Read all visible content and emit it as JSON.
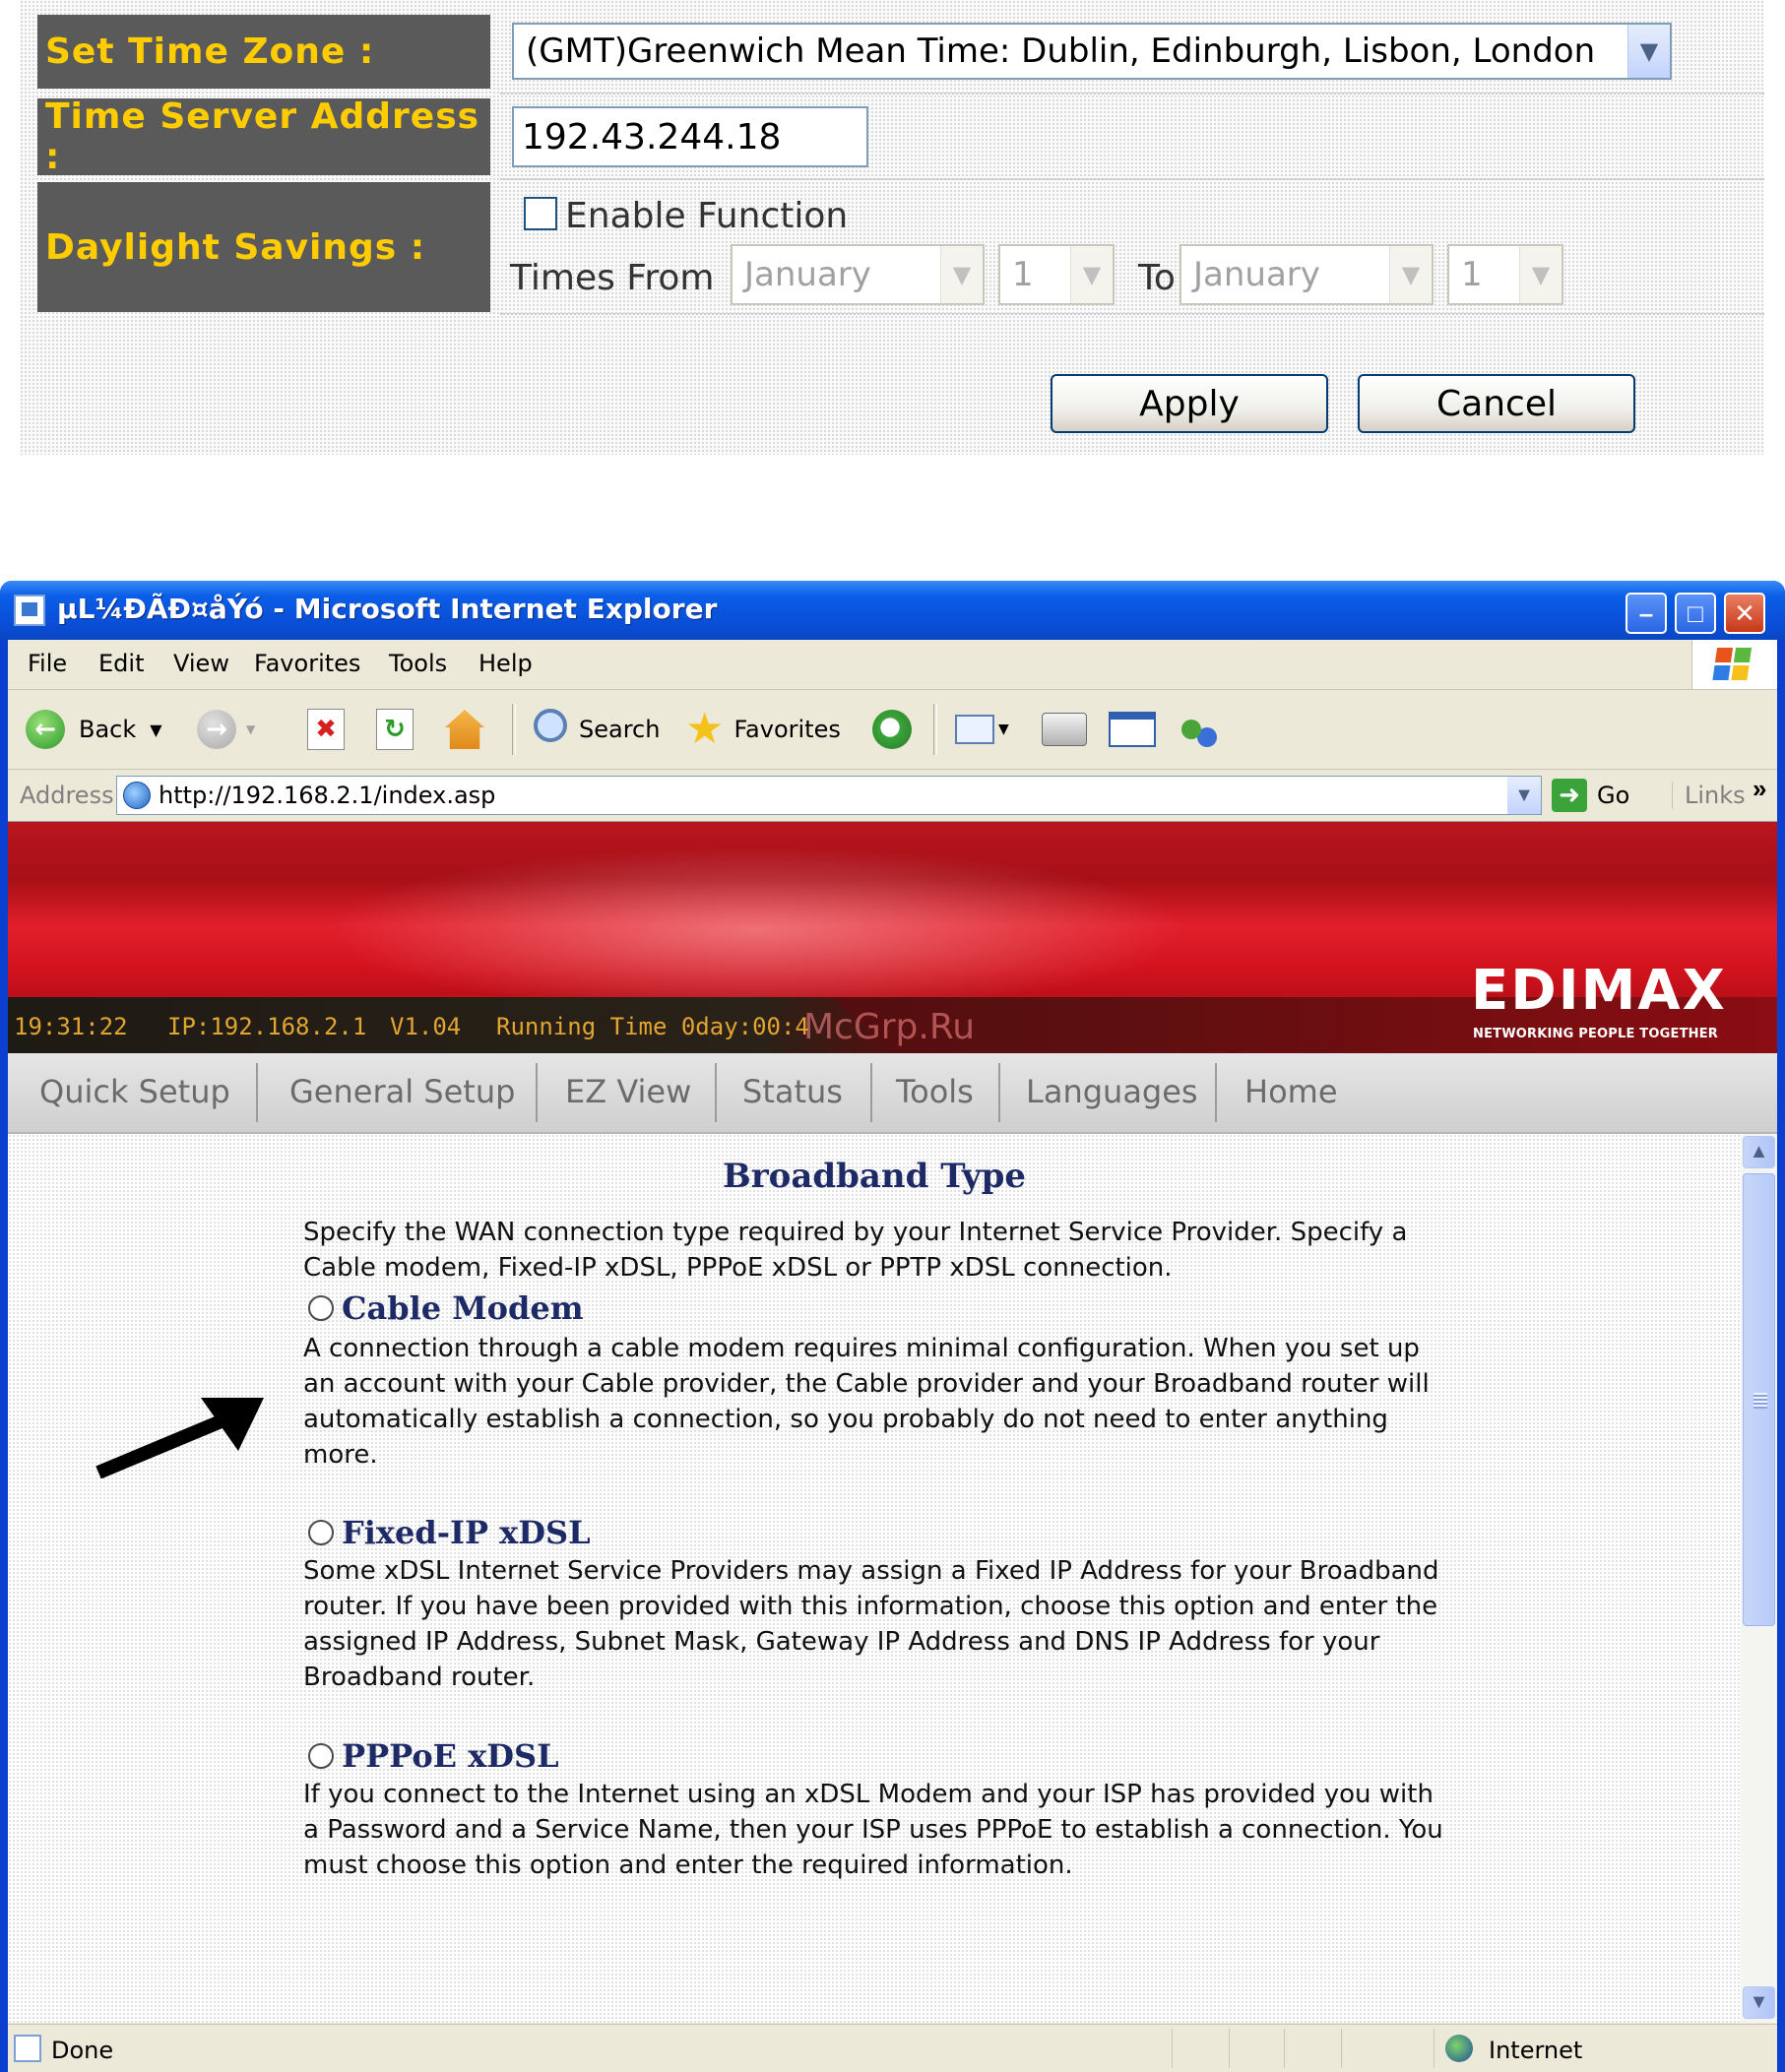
{
  "time_settings": {
    "time_zone_label": "Set Time Zone :",
    "time_zone_value": "(GMT)Greenwich Mean Time: Dublin, Edinburgh, Lisbon, London",
    "time_server_label": "Time Server Address :",
    "time_server_value": "192.43.244.18",
    "daylight_label": "Daylight Savings :",
    "enable_function_label": "Enable Function",
    "enable_function_checked": false,
    "times_from_label": "Times From",
    "from_month": "January",
    "from_day": "1",
    "to_label": "To",
    "to_month": "January",
    "to_day": "1",
    "apply_label": "Apply",
    "cancel_label": "Cancel",
    "label_bg_color": "#5a5a5a",
    "label_text_color": "#ffcc00"
  },
  "browser": {
    "title": "µL¼ÐÃÐ¤åÝó - Microsoft Internet Explorer",
    "menu": [
      "File",
      "Edit",
      "View",
      "Favorites",
      "Tools",
      "Help"
    ],
    "toolbar": {
      "back_label": "Back",
      "search_label": "Search",
      "favorites_label": "Favorites"
    },
    "address_label": "Address",
    "address_url": "http://192.168.2.1/index.asp",
    "go_label": "Go",
    "links_label": "Links",
    "status_text": "Done",
    "zone_text": "Internet"
  },
  "router": {
    "status_time": "19:31:22",
    "status_ip": "IP:192.168.2.1",
    "status_version": "V1.04",
    "status_running": "Running Time 0day:00:4",
    "watermark": "McGrp.Ru",
    "logo": "EDIMAX",
    "logo_tagline": "NETWORKING PEOPLE TOGETHER",
    "nav": [
      "Quick Setup",
      "General Setup",
      "EZ View",
      "Status",
      "Tools",
      "Languages",
      "Home"
    ],
    "brand_red": "#d0121d"
  },
  "broadband": {
    "title": "Broadband Type",
    "intro": "Specify the WAN connection type required by your Internet Service Provider. Specify a Cable modem, Fixed-IP xDSL, PPPoE xDSL or PPTP xDSL connection.",
    "options": [
      {
        "label": "Cable Modem",
        "description": "A connection through a cable modem requires minimal configuration. When you set up an account with your Cable provider, the Cable provider and your Broadband router will automatically establish a connection, so you probably do not need to enter anything more."
      },
      {
        "label": "Fixed-IP xDSL",
        "description": "Some xDSL Internet Service Providers may assign a Fixed IP Address for your Broadband router. If you have been provided with this information, choose this option and enter the assigned IP Address, Subnet Mask, Gateway IP Address and DNS IP Address for your Broadband router."
      },
      {
        "label": "PPPoE xDSL",
        "description": "If you connect to the Internet using an xDSL Modem and your ISP has provided you with a Password and a Service Name, then your ISP uses PPPoE to establish a connection. You must choose this option and enter the required information."
      }
    ]
  },
  "icons": [
    "back-icon",
    "forward-icon",
    "stop-icon",
    "refresh-icon",
    "home-icon",
    "search-icon",
    "favorites-star-icon",
    "history-icon",
    "mail-icon",
    "print-icon",
    "edit-icon",
    "messenger-icon",
    "go-arrow-icon",
    "internet-zone-icon"
  ]
}
